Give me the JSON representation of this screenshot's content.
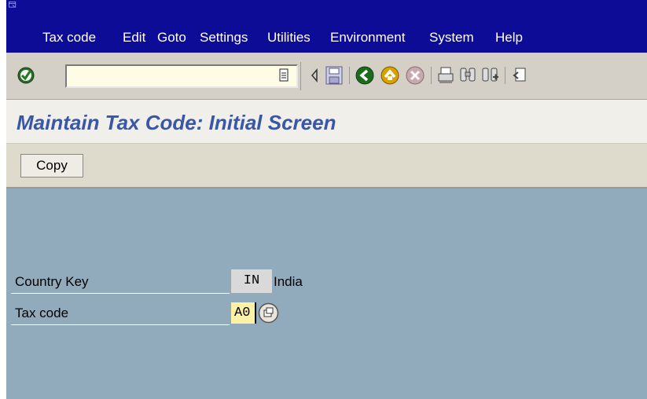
{
  "menubar": {
    "items": [
      {
        "label": "Tax code"
      },
      {
        "label": "Edit"
      },
      {
        "label": "Goto"
      },
      {
        "label": "Settings"
      },
      {
        "label": "Utilities"
      },
      {
        "label": "Environment"
      },
      {
        "label": "System"
      },
      {
        "label": "Help"
      }
    ]
  },
  "toolbar": {
    "command_field": {
      "value": "",
      "placeholder": ""
    },
    "icons": [
      "enter-icon",
      "history-icon",
      "back-arrow-icon",
      "save-icon",
      "back-icon",
      "exit-icon",
      "cancel-icon",
      "print-icon",
      "find-icon",
      "find-next-icon",
      "first-page-icon"
    ]
  },
  "title": "Maintain Tax Code: Initial Screen",
  "app_toolbar": {
    "copy_label": "Copy"
  },
  "form": {
    "country_key": {
      "label": "Country Key",
      "value": "IN",
      "description": "India"
    },
    "tax_code": {
      "label": "Tax code",
      "value": "A0"
    }
  },
  "colors": {
    "menubar_bg": "#0c0c97",
    "title_text": "#3a56a6",
    "main_bg": "#91abbd",
    "input_bg": "#fff2a6"
  }
}
